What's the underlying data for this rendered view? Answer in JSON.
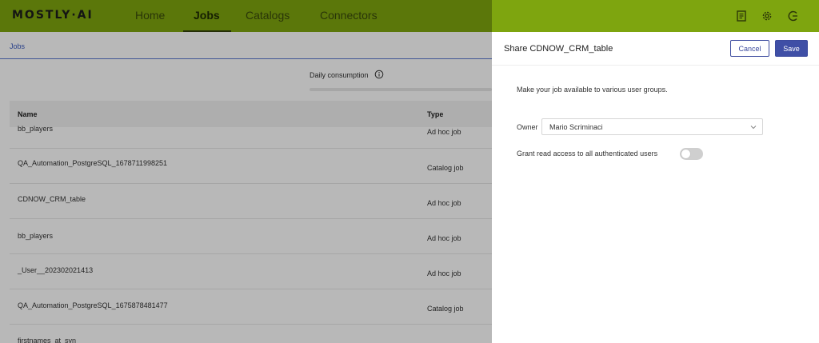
{
  "app": {
    "logo": "MOSTLY·AI"
  },
  "nav": {
    "items": [
      {
        "label": "Home",
        "active": false
      },
      {
        "label": "Jobs",
        "active": true
      },
      {
        "label": "Catalogs",
        "active": false
      },
      {
        "label": "Connectors",
        "active": false
      }
    ],
    "icons": [
      "document-icon",
      "gear-icon",
      "logout-icon"
    ]
  },
  "page": {
    "breadcrumb": "Jobs",
    "consumption_label": "Daily consumption",
    "table": {
      "headers": {
        "name": "Name",
        "type": "Type"
      },
      "rows": [
        {
          "name": "bb_players",
          "type": "Ad hoc job"
        },
        {
          "name": "QA_Automation_PostgreSQL_1678711998251",
          "type": "Catalog job"
        },
        {
          "name": "CDNOW_CRM_table",
          "type": "Ad hoc job"
        },
        {
          "name": "bb_players",
          "type": "Ad hoc job"
        },
        {
          "name": "_User__202302021413",
          "type": "Ad hoc job"
        },
        {
          "name": "QA_Automation_PostgreSQL_1675878481477",
          "type": "Catalog job"
        },
        {
          "name": "firstnames_at_syn",
          "type": ""
        }
      ]
    }
  },
  "share_panel": {
    "title": "Share CDNOW_CRM_table",
    "cancel_label": "Cancel",
    "save_label": "Save",
    "description": "Make your job available to various user groups.",
    "owner_label": "Owner",
    "owner_value": "Mario Scriminaci",
    "grant_label": "Grant read access to all authenticated users",
    "grant_enabled": false
  },
  "colors": {
    "brand_green": "#7ea50f",
    "primary_blue": "#3f4fa6",
    "link_blue": "#3b5bbf"
  }
}
